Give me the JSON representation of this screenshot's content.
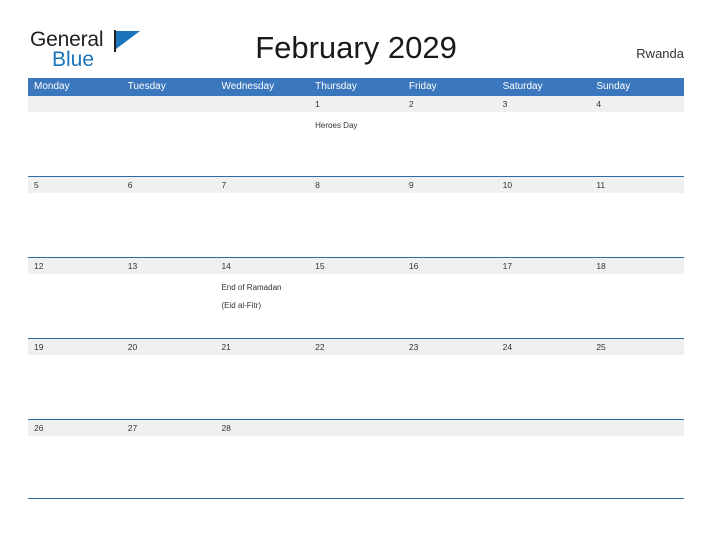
{
  "brand": {
    "name_part1": "General",
    "name_part2": "Blue",
    "flag_icon": "flag-triangle-icon",
    "accent_color": "#1b75bb"
  },
  "header": {
    "title": "February 2029",
    "region": "Rwanda"
  },
  "colors": {
    "weekday_header_bg": "#3a77bd",
    "weekday_header_text": "#ffffff",
    "date_band_bg": "#f0f0f0",
    "row_divider": "#2e6da4",
    "body_bg": "#ffffff",
    "text": "#333333"
  },
  "calendar": {
    "weekdays": [
      "Monday",
      "Tuesday",
      "Wednesday",
      "Thursday",
      "Friday",
      "Saturday",
      "Sunday"
    ],
    "weeks": [
      {
        "dates": [
          "",
          "",
          "",
          "1",
          "2",
          "3",
          "4"
        ],
        "events": [
          "",
          "",
          "",
          "Heroes Day",
          "",
          "",
          ""
        ]
      },
      {
        "dates": [
          "5",
          "6",
          "7",
          "8",
          "9",
          "10",
          "11"
        ],
        "events": [
          "",
          "",
          "",
          "",
          "",
          "",
          ""
        ]
      },
      {
        "dates": [
          "12",
          "13",
          "14",
          "15",
          "16",
          "17",
          "18"
        ],
        "events": [
          "",
          "",
          "End of Ramadan\n(Eid al-Fitr)",
          "",
          "",
          "",
          ""
        ]
      },
      {
        "dates": [
          "19",
          "20",
          "21",
          "22",
          "23",
          "24",
          "25"
        ],
        "events": [
          "",
          "",
          "",
          "",
          "",
          "",
          ""
        ]
      },
      {
        "dates": [
          "26",
          "27",
          "28",
          "",
          "",
          "",
          ""
        ],
        "events": [
          "",
          "",
          "",
          "",
          "",
          "",
          ""
        ]
      }
    ]
  }
}
